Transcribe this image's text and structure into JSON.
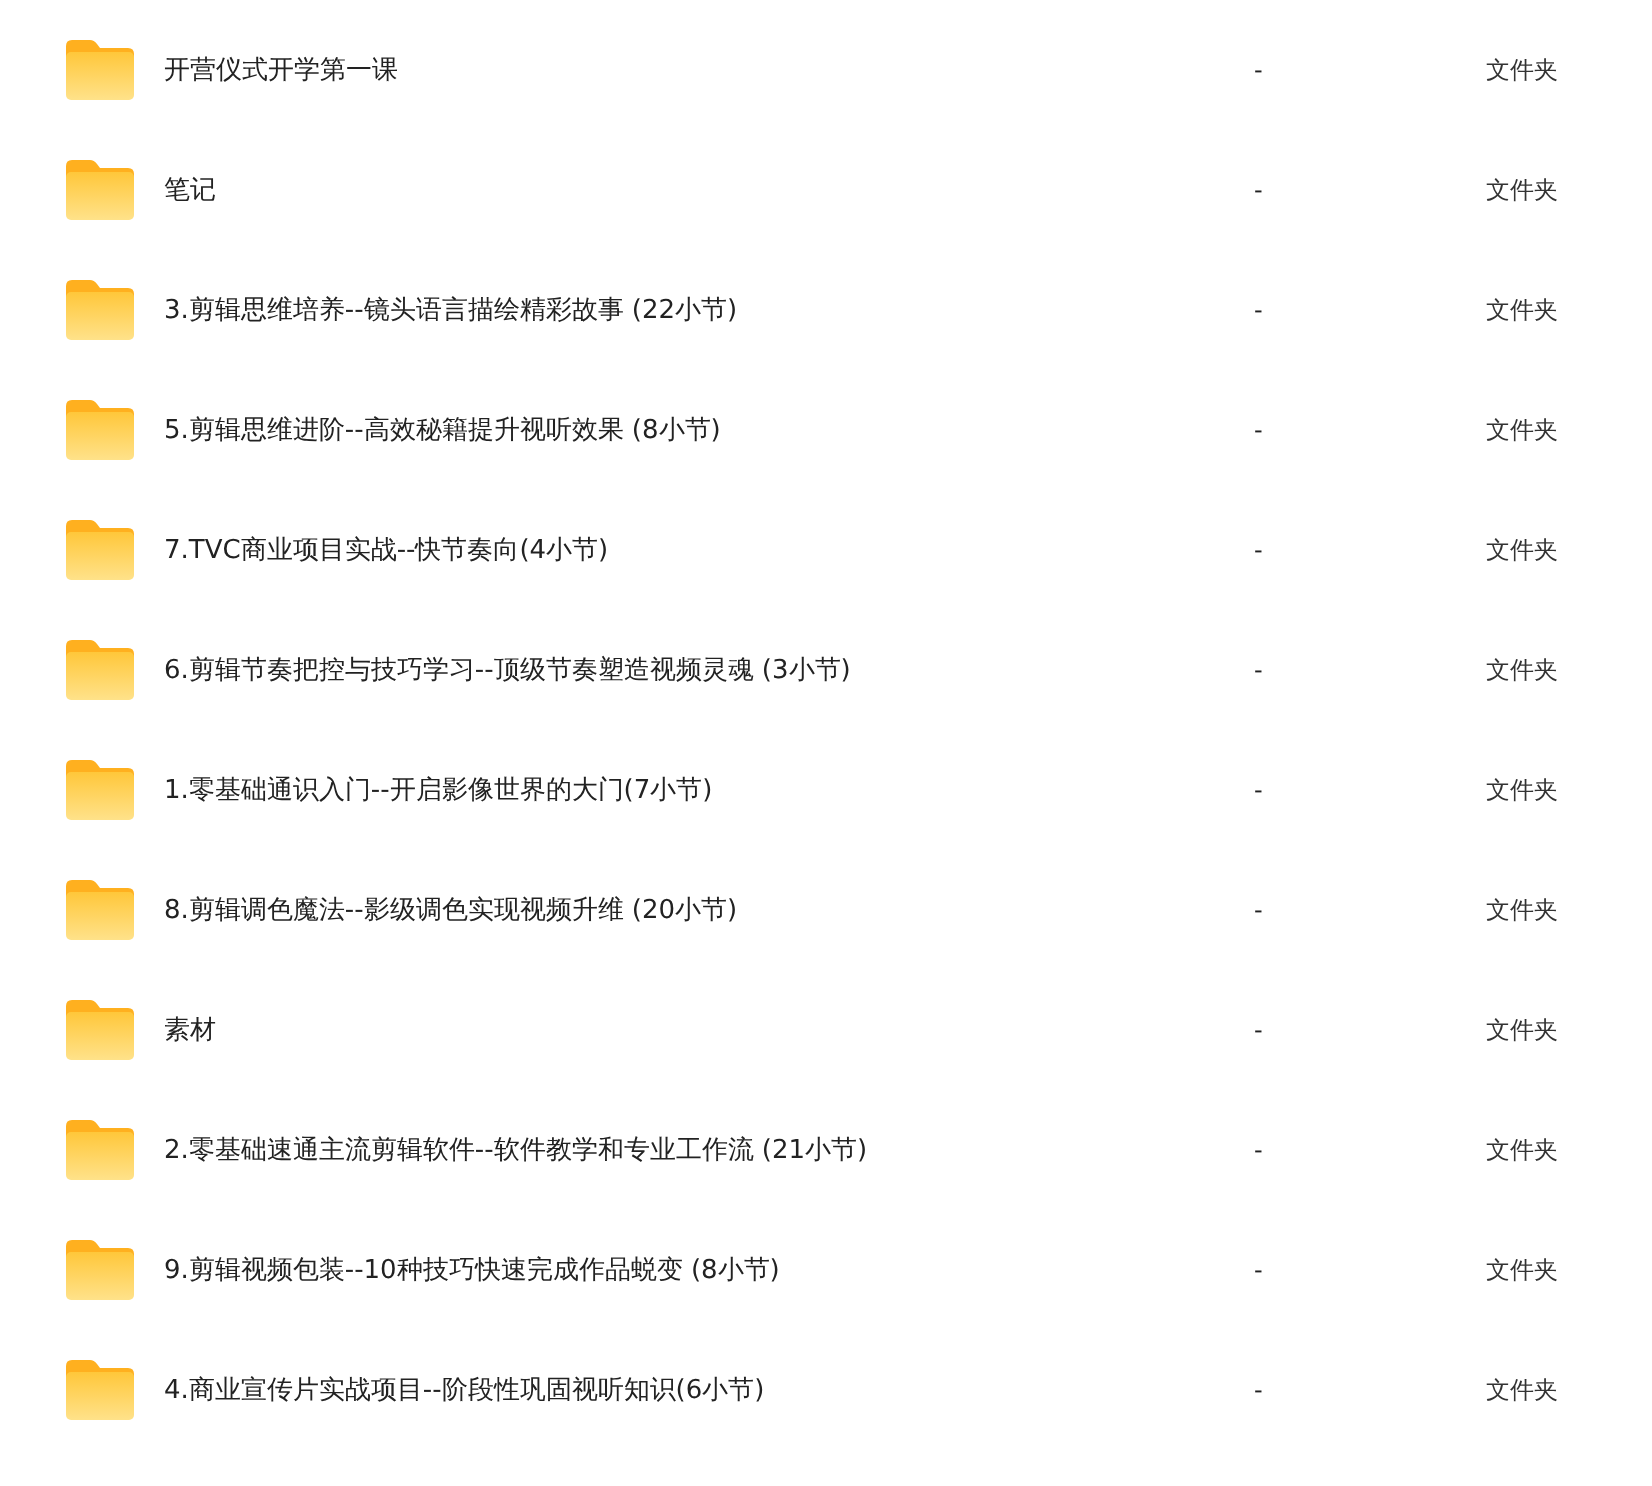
{
  "items": [
    {
      "name": "开营仪式开学第一课",
      "size": "-",
      "type": "文件夹"
    },
    {
      "name": "笔记",
      "size": "-",
      "type": "文件夹"
    },
    {
      "name": "3.剪辑思维培养--镜头语言描绘精彩故事 (22小节)",
      "size": "-",
      "type": "文件夹"
    },
    {
      "name": "5.剪辑思维进阶--高效秘籍提升视听效果 (8小节)",
      "size": "-",
      "type": "文件夹"
    },
    {
      "name": "7.TVC商业项目实战--快节奏向(4小节)",
      "size": "-",
      "type": "文件夹"
    },
    {
      "name": "6.剪辑节奏把控与技巧学习--顶级节奏塑造视频灵魂 (3小节)",
      "size": "-",
      "type": "文件夹"
    },
    {
      "name": "1.零基础通识入门--开启影像世界的大门(7小节)",
      "size": "-",
      "type": "文件夹"
    },
    {
      "name": "8.剪辑调色魔法--影级调色实现视频升维 (20小节)",
      "size": "-",
      "type": "文件夹"
    },
    {
      "name": "素材",
      "size": "-",
      "type": "文件夹"
    },
    {
      "name": "2.零基础速通主流剪辑软件--软件教学和专业工作流 (21小节)",
      "size": "-",
      "type": "文件夹"
    },
    {
      "name": "9.剪辑视频包装--10种技巧快速完成作品蜕变 (8小节)",
      "size": "-",
      "type": "文件夹"
    },
    {
      "name": "4.商业宣传片实战项目--阶段性巩固视听知识(6小节)",
      "size": "-",
      "type": "文件夹"
    }
  ]
}
